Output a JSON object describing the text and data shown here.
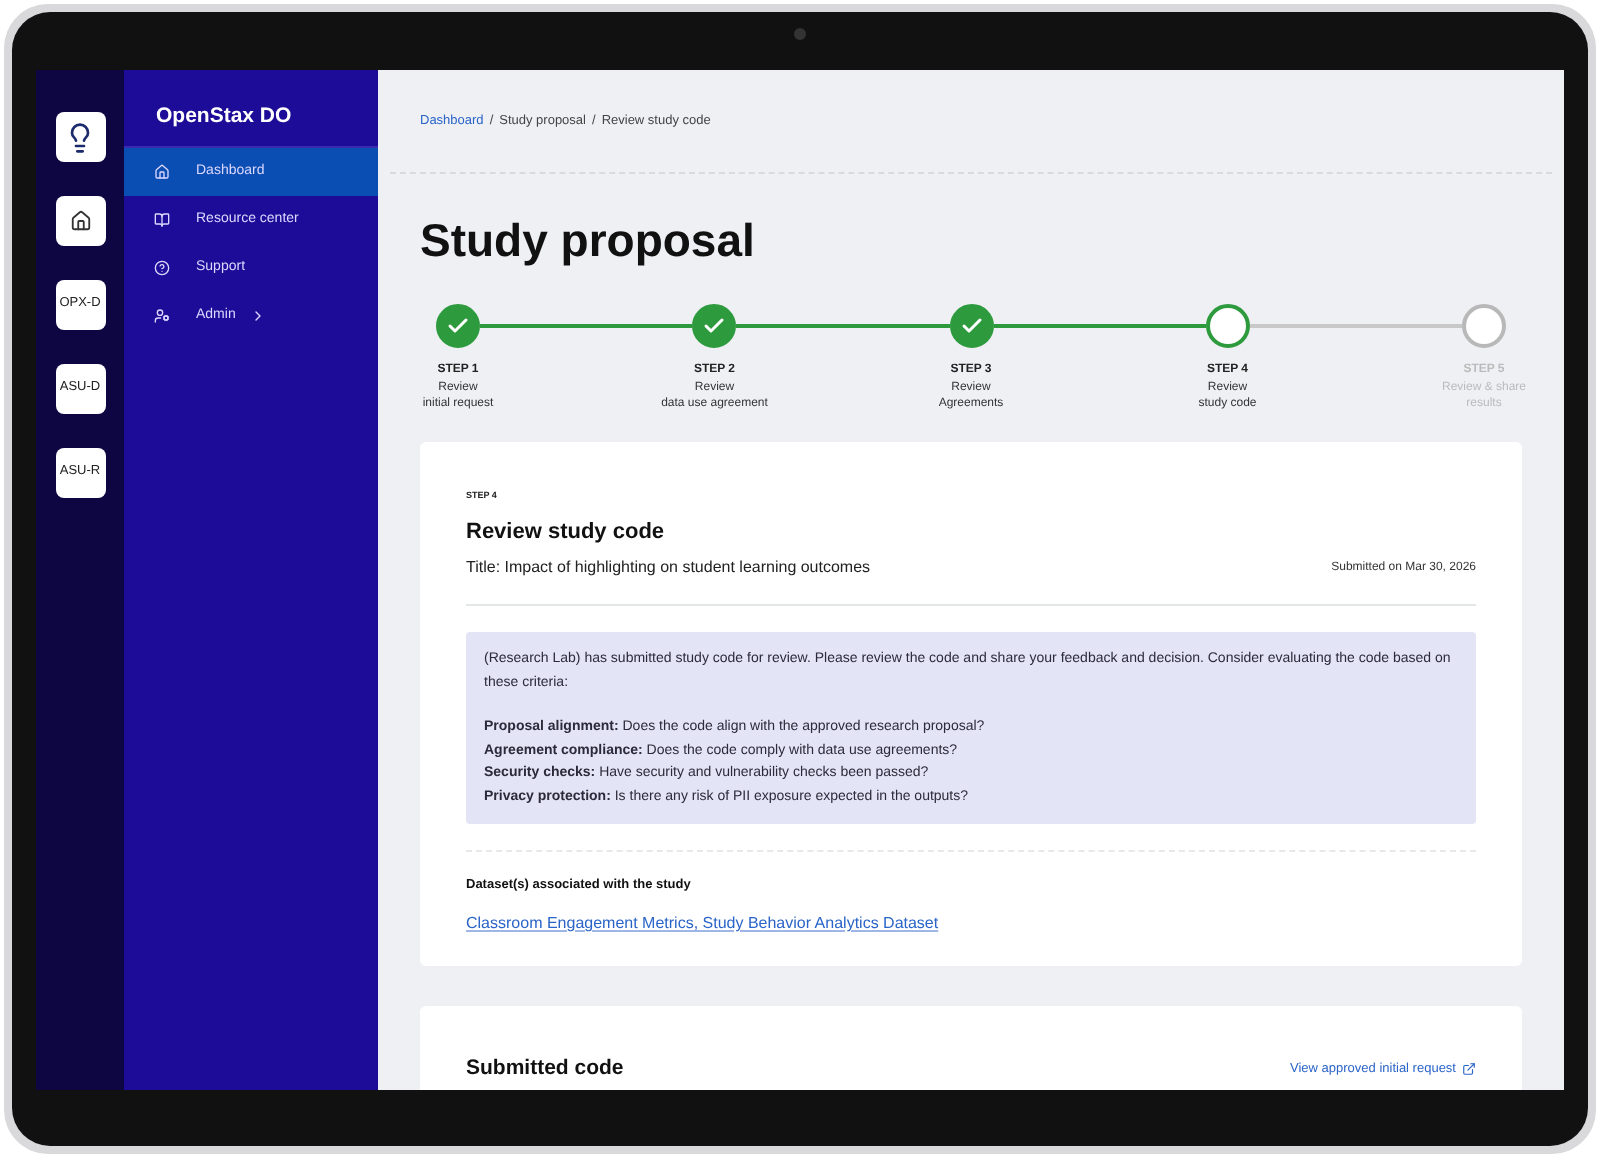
{
  "rail": {
    "items": [
      {
        "kind": "home"
      },
      {
        "kind": "text",
        "label": "OPX-D"
      },
      {
        "kind": "text",
        "label": "ASU-D"
      },
      {
        "kind": "text",
        "label": "ASU-R"
      }
    ]
  },
  "sidebar": {
    "title": "OpenStax DO",
    "items": [
      {
        "kind": "dashboard",
        "label": "Dashboard",
        "selected": true
      },
      {
        "kind": "resources",
        "label": "Resource center",
        "selected": false
      },
      {
        "kind": "support",
        "label": "Support",
        "selected": false
      },
      {
        "kind": "admin",
        "label": "Admin",
        "selected": false,
        "expandable": true
      }
    ]
  },
  "breadcrumb_separator": "/",
  "breadcrumb": [
    {
      "label": "Dashboard",
      "link": true
    },
    {
      "label": "Study proposal",
      "link": false
    },
    {
      "label": "Review study code",
      "link": false
    }
  ],
  "page_title": "Study proposal",
  "steps": [
    {
      "step": "STEP 1",
      "lines": [
        "Review",
        "initial request"
      ],
      "done": true,
      "current": false
    },
    {
      "step": "STEP 2",
      "lines": [
        "Review",
        "data use agreement"
      ],
      "done": true,
      "current": false
    },
    {
      "step": "STEP 3",
      "lines": [
        "Review",
        "Agreements"
      ],
      "done": true,
      "current": false
    },
    {
      "step": "STEP 4",
      "lines": [
        "Review",
        "study code"
      ],
      "done": false,
      "current": true
    },
    {
      "step": "STEP 5",
      "lines": [
        "Review & share",
        "results"
      ],
      "done": false,
      "current": false
    }
  ],
  "review_card": {
    "step": "STEP 4",
    "heading": "Review study code",
    "title": "Title: Impact of highlighting on student learning outcomes",
    "submitted": "Submitted on Mar 30, 2026",
    "intro": "(Research Lab) has submitted study code for review. Please review the code and share your feedback and decision. Consider evaluating the code based on these criteria:",
    "criteria": [
      "**Proposal alignment:** Does the code align with the approved research proposal?",
      "**Agreement compliance:** Does the code comply with data use agreements?",
      "**Security checks:** Have security and vulnerability checks been passed?",
      "**Privacy protection:** Is there any risk of PII exposure expected in the outputs?"
    ],
    "datasets_label": "Dataset(s) associated with the study",
    "datasets": "Classroom Engagement Metrics, Study Behavior Analytics Dataset"
  },
  "code_card": {
    "heading": "Submitted code",
    "link": "View approved initial request"
  }
}
